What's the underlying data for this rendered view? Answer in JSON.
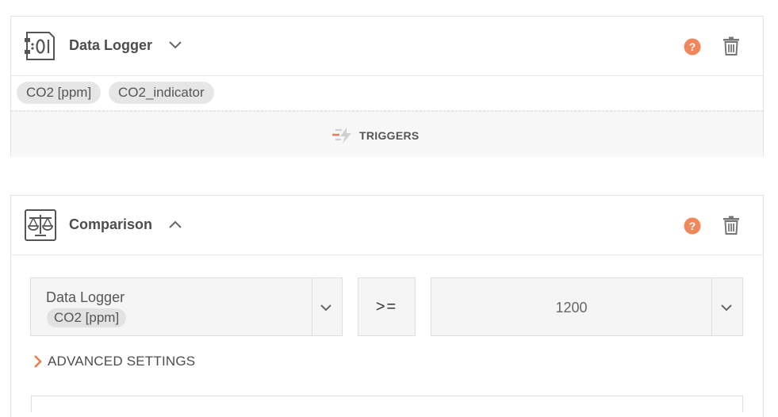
{
  "data_logger_block": {
    "title": "Data Logger",
    "icon": "data-logger-icon",
    "tags": [
      "CO2 [ppm]",
      "CO2_indicator"
    ],
    "triggers_label": "TRIGGERS"
  },
  "comparison_block": {
    "title": "Comparison",
    "icon": "scale-icon",
    "source": {
      "label": "Data Logger",
      "chip": "CO2 [ppm]"
    },
    "operator": ">=",
    "value": "1200",
    "advanced_label": "ADVANCED SETTINGS"
  },
  "colors": {
    "accent": "#f07c52",
    "help": "#f0865a",
    "text": "#4a4a4a",
    "border": "#e4e4e4",
    "chip_bg": "#e6e6e6"
  }
}
